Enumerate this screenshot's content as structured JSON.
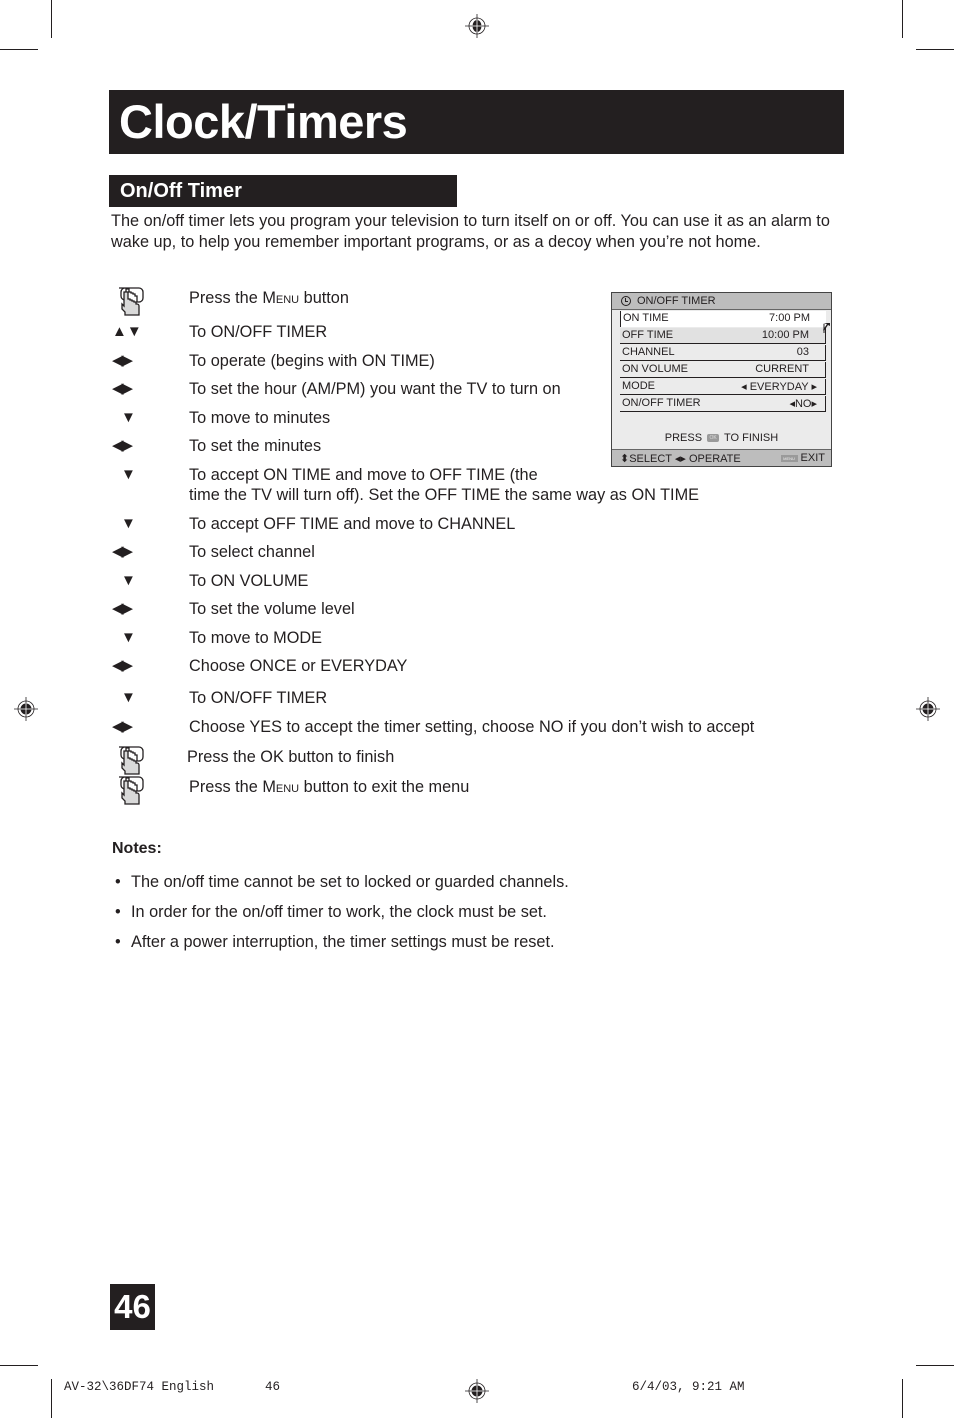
{
  "header": {
    "title": "Clock/Timers",
    "section_title": "On/Off Timer"
  },
  "intro": "The on/off timer lets you program your television to turn itself on or off. You can use it as an alarm to wake up, to help you remember important programs, or as a decoy when you’re not home.",
  "steps": [
    {
      "icon": "hand-press-icon",
      "text_pre": "Press the ",
      "text_sc": "Menu",
      "text_post": " button"
    },
    {
      "icon": "up-down-arrows-icon",
      "glyph": "▲▼",
      "text": "To ON/OFF TIMER"
    },
    {
      "icon": "left-right-arrows-icon",
      "glyph": "◀▶",
      "text": "To operate (begins with ON TIME)"
    },
    {
      "icon": "left-right-arrows-icon",
      "glyph": "◀▶",
      "text": "To set the hour (AM/PM) you want the TV to turn on"
    },
    {
      "icon": "down-arrow-icon",
      "glyph": "▼",
      "text": "To move to minutes"
    },
    {
      "icon": "left-right-arrows-icon",
      "glyph": "◀▶",
      "text": "To set the minutes"
    },
    {
      "icon": "down-arrow-icon",
      "glyph": "▼",
      "text": "To accept ON TIME and move to OFF TIME (the",
      "text2": "time the TV will turn off). Set the OFF TIME the same way as ON TIME"
    },
    {
      "icon": "down-arrow-icon",
      "glyph": "▼",
      "text": "To accept OFF TIME and move to CHANNEL"
    },
    {
      "icon": "left-right-arrows-icon",
      "glyph": "◀▶",
      "text": "To select channel"
    },
    {
      "icon": "down-arrow-icon",
      "glyph": "▼",
      "text": "To ON VOLUME"
    },
    {
      "icon": "left-right-arrows-icon",
      "glyph": "◀▶",
      "text": "To set the volume level"
    },
    {
      "icon": "down-arrow-icon",
      "glyph": "▼",
      "text": "To move to MODE"
    },
    {
      "icon": "left-right-arrows-icon",
      "glyph": "◀▶",
      "text": "Choose ONCE or EVERYDAY"
    },
    {
      "icon": "down-arrow-icon",
      "glyph": "▼",
      "text": "To ON/OFF TIMER"
    },
    {
      "icon": "left-right-arrows-icon",
      "glyph": "◀▶",
      "text": "Choose YES to accept the timer setting, choose NO if you don’t wish to accept"
    },
    {
      "icon": "hand-press-icon",
      "text": "Press the OK button to finish"
    },
    {
      "icon": "hand-press-icon",
      "text_pre": "Press the ",
      "text_sc": "Menu",
      "text_post": " button to exit the menu"
    }
  ],
  "osd": {
    "title": "ON/OFF TIMER",
    "rows": [
      {
        "label": "ON TIME",
        "value": "7:00 PM"
      },
      {
        "label": "OFF TIME",
        "value": "10:00 PM"
      },
      {
        "label": "CHANNEL",
        "value": "03"
      },
      {
        "label": "ON VOLUME",
        "value": "CURRENT"
      },
      {
        "label": "MODE",
        "value": "◂ EVERYDAY ▸"
      },
      {
        "label": "ON/OFF TIMER",
        "value": "◂NO▸"
      }
    ],
    "finish_pre": "PRESS",
    "ok_chip": "OK",
    "finish_post": "TO FINISH",
    "footer_select": "⬍SELECT ◂▸ OPERATE",
    "menu_chip": "MENU",
    "footer_exit": "EXIT"
  },
  "notes": {
    "title": "Notes:",
    "items": [
      "The on/off time cannot be set to locked or guarded channels.",
      "In order for the on/off timer to work, the clock must be set.",
      "After a power interruption, the timer settings must be reset."
    ]
  },
  "page_number": "46",
  "slug": {
    "file": "AV-32\\36DF74 English",
    "page": "46",
    "date": "6/4/03, 9:21 AM"
  }
}
